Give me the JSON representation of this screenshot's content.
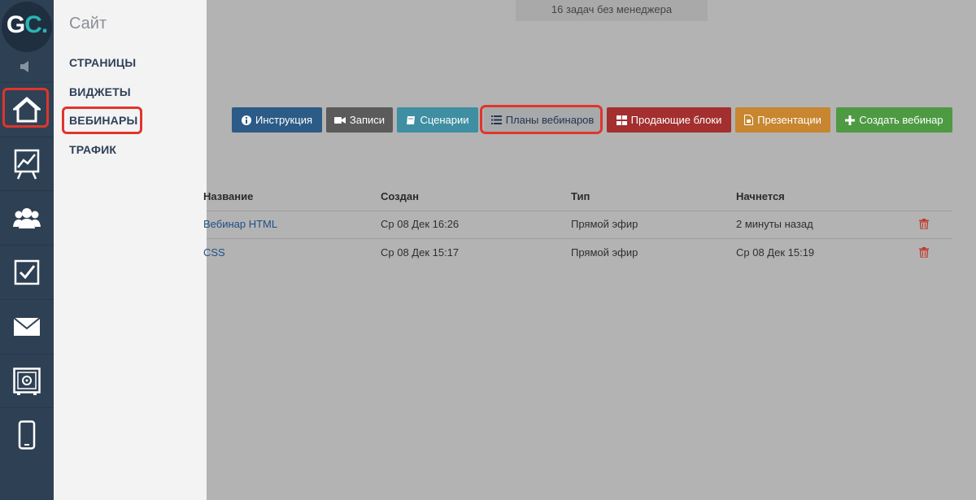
{
  "logo": {
    "letters": "G",
    "accent": "C."
  },
  "menu": {
    "title": "Сайт",
    "items": [
      {
        "label": "СТРАНИЦЫ"
      },
      {
        "label": "ВИДЖЕТЫ"
      },
      {
        "label": "ВЕБИНАРЫ"
      },
      {
        "label": "ТРАФИК"
      }
    ]
  },
  "rail": {
    "icons": [
      "speaker-icon",
      "home-icon",
      "chart-icon",
      "users-icon",
      "checkbox-icon",
      "mail-icon",
      "safe-icon",
      "phone-icon"
    ]
  },
  "header": {
    "tasks_label": "16 задач без менеджера"
  },
  "toolbar": {
    "instruction": "Инструкция",
    "records": "Записи",
    "scenarios": "Сценарии",
    "plans": "Планы вебинаров",
    "selling_blocks": "Продающие блоки",
    "presentations": "Презентации",
    "create": "Создать вебинар"
  },
  "table": {
    "columns": [
      "Название",
      "Создан",
      "Тип",
      "Начнется"
    ],
    "rows": [
      {
        "name": "Вебинар HTML",
        "created": "Ср 08 Дек 16:26",
        "type": "Прямой эфир",
        "starts": "2 минуты назад"
      },
      {
        "name": "CSS",
        "created": "Ср 08 Дек 15:17",
        "type": "Прямой эфир",
        "starts": "Ср 08 Дек 15:19"
      }
    ]
  },
  "colors": {
    "rail": "#2e4054",
    "highlight": "#e0352b",
    "instruction": "#2b5b86",
    "records": "#5b5b5b",
    "scenarios": "#3f8ea2",
    "plans": "#a8a9ab",
    "selling_blocks": "#a32f2e",
    "presentations": "#c7862f",
    "create": "#4d9a43",
    "link": "#1f4f86",
    "delete": "#c0392b"
  }
}
